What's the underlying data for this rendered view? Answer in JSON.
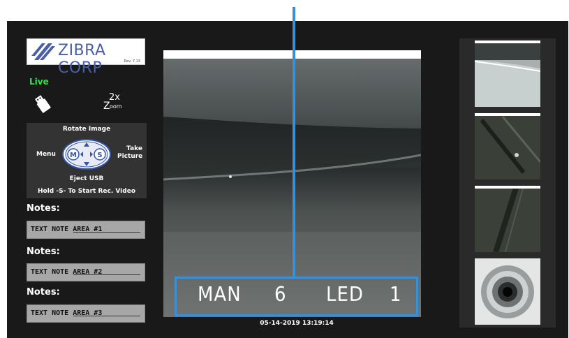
{
  "brand": {
    "logo_text": "ZIBRA CORP",
    "revision": "Rev. 7.13"
  },
  "status": {
    "live_label": "Live"
  },
  "controls": {
    "zoom_top": "2x",
    "zoom_z": "Z",
    "zoom_oom": "oom",
    "rotate_label": "Rotate Image",
    "menu_label": "Menu",
    "take_label": "Take",
    "picture_label": "Picture",
    "m_key": "M",
    "s_key": "S",
    "eject_label": "Eject USB",
    "hold_label": "Hold -S- To Start Rec. Video"
  },
  "notes": [
    {
      "label": "Notes:",
      "text": "TEXT NOTE AREA #1"
    },
    {
      "label": "Notes:",
      "text": "TEXT NOTE AREA #2"
    },
    {
      "label": "Notes:",
      "text": "TEXT NOTE AREA #3"
    }
  ],
  "hud": {
    "mode": "MAN",
    "mode_value": "6",
    "led_label": "LED",
    "led_value": "1"
  },
  "timestamp": "05-14-2019 13:19:14",
  "colors": {
    "accent_blue": "#3b8fd6",
    "live_green": "#32e24a",
    "logo_blue": "#4a5fa8"
  },
  "icons": [
    "usb-icon",
    "zoom-2x-icon",
    "dpad-icon"
  ]
}
